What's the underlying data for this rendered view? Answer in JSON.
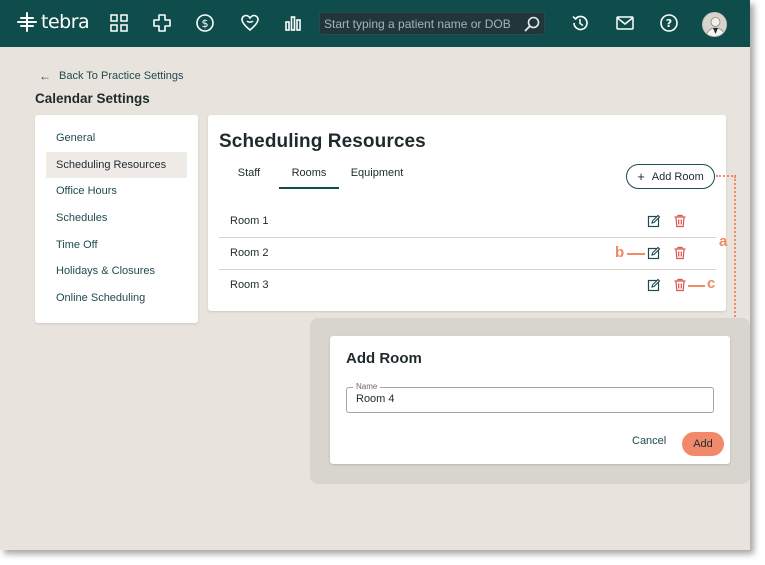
{
  "brand": {
    "name": "tebra"
  },
  "nav": {
    "icons": [
      "grid-apps-icon",
      "medical-cross-icon",
      "dollar-icon",
      "heart-hand-icon",
      "bar-chart-icon"
    ],
    "right_icons": [
      "history-icon",
      "mail-icon",
      "help-icon"
    ]
  },
  "search": {
    "placeholder": "Start typing a patient name or DOB"
  },
  "header": {
    "back_label": "Back To Practice Settings",
    "title": "Calendar Settings"
  },
  "sidebar": {
    "items": [
      {
        "label": "General"
      },
      {
        "label": "Scheduling Resources"
      },
      {
        "label": "Office Hours"
      },
      {
        "label": "Schedules"
      },
      {
        "label": "Time Off"
      },
      {
        "label": "Holidays & Closures"
      },
      {
        "label": "Online Scheduling"
      }
    ],
    "active_index": 1
  },
  "main": {
    "title": "Scheduling Resources",
    "tabs": [
      {
        "label": "Staff"
      },
      {
        "label": "Rooms"
      },
      {
        "label": "Equipment"
      }
    ],
    "active_tab": "Rooms",
    "add_button": "Add Room",
    "rooms": [
      {
        "name": "Room 1"
      },
      {
        "name": "Room 2"
      },
      {
        "name": "Room 3"
      }
    ]
  },
  "annotations": {
    "a": "a",
    "b": "b",
    "c": "c"
  },
  "modal": {
    "title": "Add Room",
    "field_label": "Name",
    "field_value": "Room 4",
    "cancel_label": "Cancel",
    "add_label": "Add"
  },
  "colors": {
    "header_bg": "#0f4c4c",
    "page_bg": "#e8e4dd",
    "accent": "#f2896a",
    "delete_icon": "#d9534f",
    "annotation": "#ee8a64"
  }
}
